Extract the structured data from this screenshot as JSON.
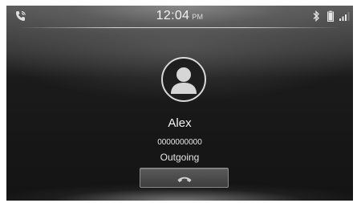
{
  "status_bar": {
    "time": "12:04",
    "ampm": "PM",
    "icons": [
      "phone-call-icon",
      "bluetooth-icon",
      "battery-icon",
      "signal-icon"
    ]
  },
  "call": {
    "contact_name": "Alex",
    "number": "0000000000",
    "status": "Outgoing",
    "end_call_icon": "hang-up-icon"
  },
  "colors": {
    "text": "#f4f4f4",
    "button": "#4a4a4a",
    "icon": "#d0d0d0"
  }
}
